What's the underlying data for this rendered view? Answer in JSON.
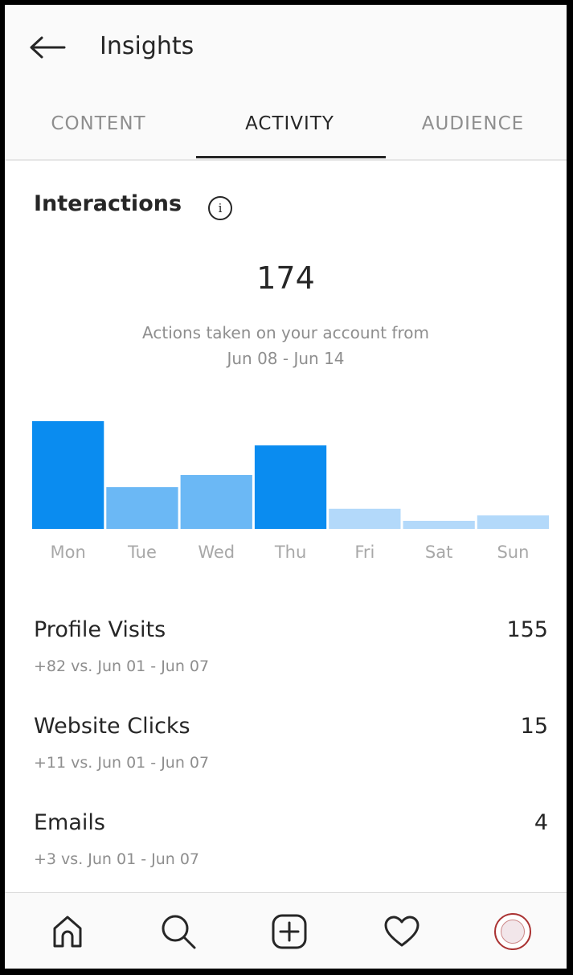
{
  "header": {
    "title": "Insights"
  },
  "tabs": [
    {
      "label": "CONTENT"
    },
    {
      "label": "ACTIVITY"
    },
    {
      "label": "AUDIENCE"
    }
  ],
  "interactions": {
    "title": "Interactions",
    "info_symbol": "i",
    "total": "174",
    "subtitle_line1": "Actions taken on your account from",
    "subtitle_line2": "Jun 08 - Jun 14"
  },
  "chart_data": {
    "type": "bar",
    "categories": [
      "Mon",
      "Tue",
      "Wed",
      "Thu",
      "Fri",
      "Sat",
      "Sun"
    ],
    "values": [
      40,
      15.5,
      20,
      31,
      7.5,
      3,
      5
    ],
    "colors": {
      "Mon": "#0a8cf0",
      "Tue": "#6bb8f5",
      "Wed": "#6bb8f5",
      "Thu": "#0a8cf0",
      "Fri": "#b3d9fa",
      "Sat": "#b3d9fa",
      "Sun": "#b3d9fa"
    },
    "label_color": "#a8a8a8"
  },
  "stats": [
    {
      "label": "Profile Visits",
      "value": "155",
      "compare": "+82 vs. Jun 01 - Jun 07"
    },
    {
      "label": "Website Clicks",
      "value": "15",
      "compare": "+11 vs. Jun 01 - Jun 07"
    },
    {
      "label": "Emails",
      "value": "4",
      "compare": "+3 vs. Jun 01 - Jun 07"
    }
  ],
  "nav": {
    "icons": [
      "home-icon",
      "search-icon",
      "new-post-icon",
      "activity-heart-icon",
      "profile-avatar"
    ]
  }
}
